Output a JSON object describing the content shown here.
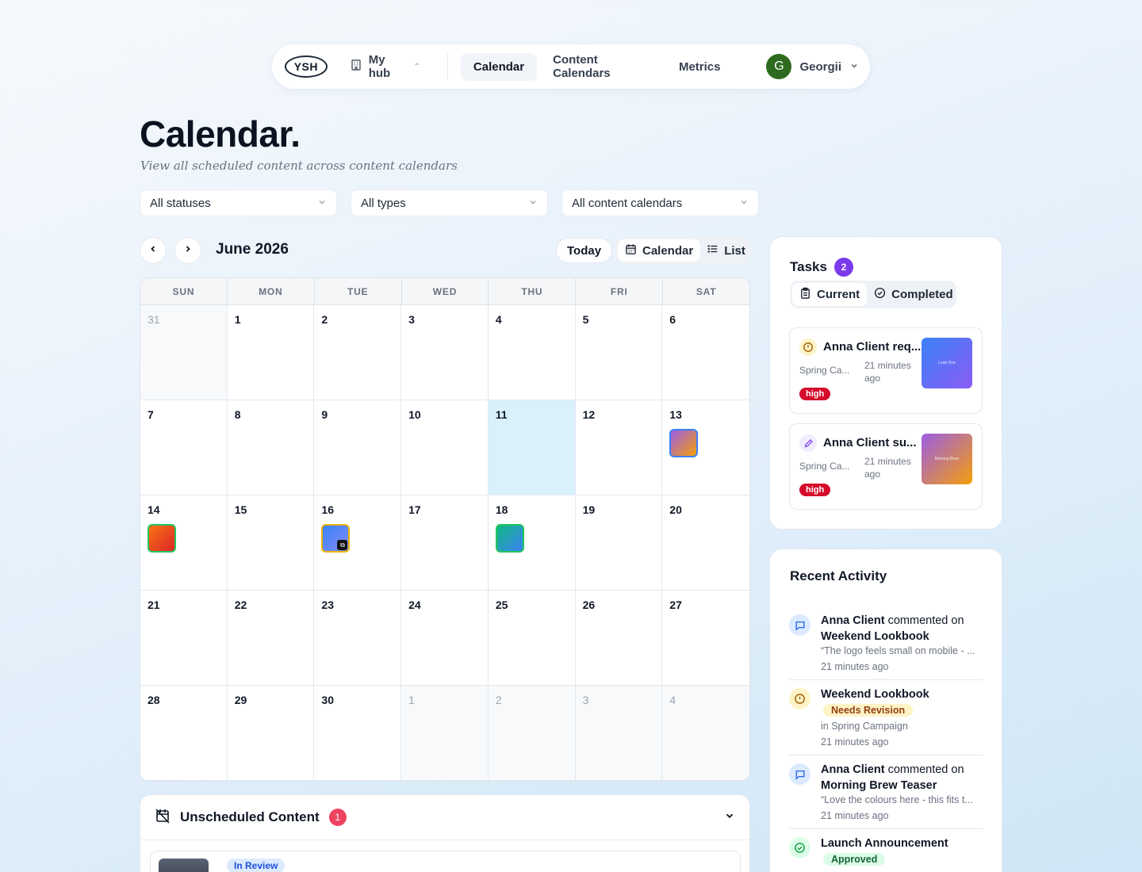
{
  "nav": {
    "logo": "YSH",
    "hub_label": "My hub",
    "items": [
      "Calendar",
      "Content Calendars",
      "Metrics"
    ],
    "active": "Calendar",
    "user_initial": "G",
    "user_name": "Georgii"
  },
  "page": {
    "title": "Calendar.",
    "subtitle": "View all scheduled content across content calendars"
  },
  "filters": [
    {
      "label": "All statuses"
    },
    {
      "label": "All types"
    },
    {
      "label": "All content calendars"
    }
  ],
  "toolbar": {
    "month": "June 2026",
    "today_label": "Today",
    "view_calendar": "Calendar",
    "view_list": "List",
    "active_view": "Calendar"
  },
  "calendar": {
    "weekdays": [
      "SUN",
      "MON",
      "TUE",
      "WED",
      "THU",
      "FRI",
      "SAT"
    ],
    "weeks": [
      [
        "31",
        "1",
        "2",
        "3",
        "4",
        "5",
        "6"
      ],
      [
        "7",
        "8",
        "9",
        "10",
        "11",
        "12",
        "13"
      ],
      [
        "14",
        "15",
        "16",
        "17",
        "18",
        "19",
        "20"
      ],
      [
        "21",
        "22",
        "23",
        "24",
        "25",
        "26",
        "27"
      ],
      [
        "28",
        "29",
        "30",
        "1",
        "2",
        "3",
        "4"
      ]
    ],
    "today": "11"
  },
  "unscheduled": {
    "title": "Unscheduled Content",
    "count": "1",
    "item_status": "In Review"
  },
  "tasks": {
    "title": "Tasks",
    "count": "2",
    "tab_current": "Current",
    "tab_completed": "Completed",
    "items": [
      {
        "title": "Anna Client req...",
        "campaign": "Spring Ca...",
        "time": "21 minutes ago",
        "priority": "high",
        "thumb_text": "Look One"
      },
      {
        "title": "Anna Client su...",
        "campaign": "Spring Ca...",
        "time": "21 minutes ago",
        "priority": "high",
        "thumb_text": "Morning Brew"
      }
    ]
  },
  "activity": {
    "title": "Recent Activity",
    "items": [
      {
        "actor": "Anna Client",
        "verb": "commented on",
        "target": "Weekend Lookbook",
        "quote": "“The logo feels small on mobile - ...",
        "time": "21 minutes ago"
      },
      {
        "target": "Weekend Lookbook",
        "status": "Needs Revision",
        "campaign": "in Spring Campaign",
        "time": "21 minutes ago"
      },
      {
        "actor": "Anna Client",
        "verb": "commented on",
        "target": "Morning Brew Teaser",
        "quote": "“Love the colours here - this fits t...",
        "time": "21 minutes ago"
      },
      {
        "target": "Launch Announcement",
        "status": "Approved"
      }
    ]
  }
}
